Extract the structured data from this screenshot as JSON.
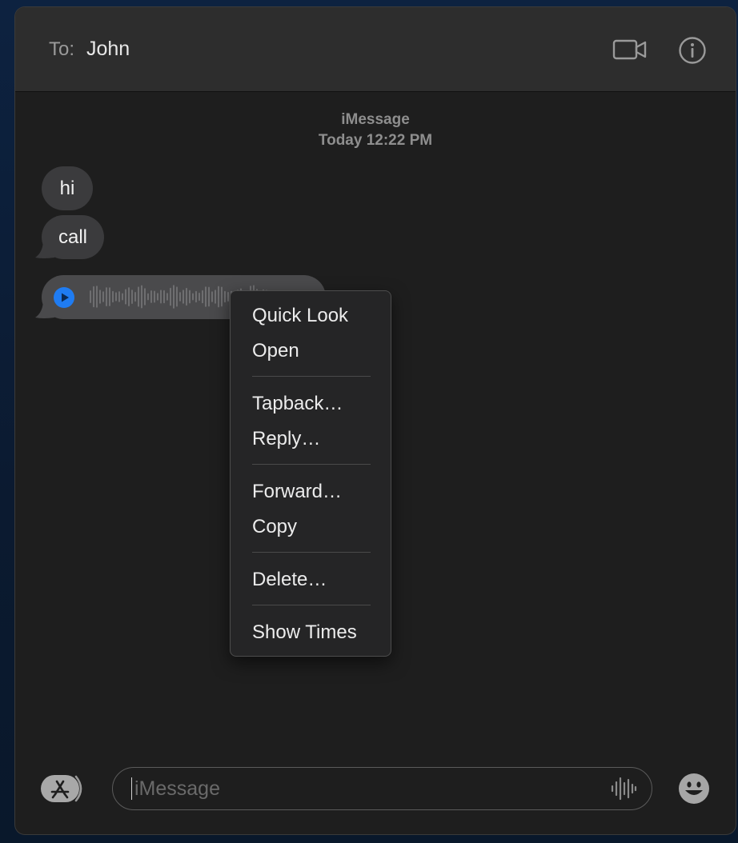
{
  "header": {
    "to_label": "To:",
    "recipient": "John"
  },
  "conversation": {
    "service": "iMessage",
    "timestamp": "Today 12:22 PM",
    "messages": [
      {
        "text": "hi"
      },
      {
        "text": "call"
      }
    ]
  },
  "context_menu": {
    "items": [
      {
        "label": "Quick Look"
      },
      {
        "label": "Open"
      },
      {
        "label": "Tapback…"
      },
      {
        "label": "Reply…"
      },
      {
        "label": "Forward…"
      },
      {
        "label": "Copy"
      },
      {
        "label": "Delete…"
      },
      {
        "label": "Show Times"
      }
    ]
  },
  "composer": {
    "placeholder": "iMessage"
  },
  "icons": {
    "video": "video-camera-icon",
    "info": "info-icon",
    "play": "play-icon",
    "apps": "app-store-icon",
    "audio": "waveform-icon",
    "emoji": "emoji-icon"
  },
  "colors": {
    "accent_blue": "#1f7cf2",
    "bubble_gray": "#3b3b3d",
    "window_bg": "#1e1e1e",
    "header_bg": "#2d2d2d"
  }
}
